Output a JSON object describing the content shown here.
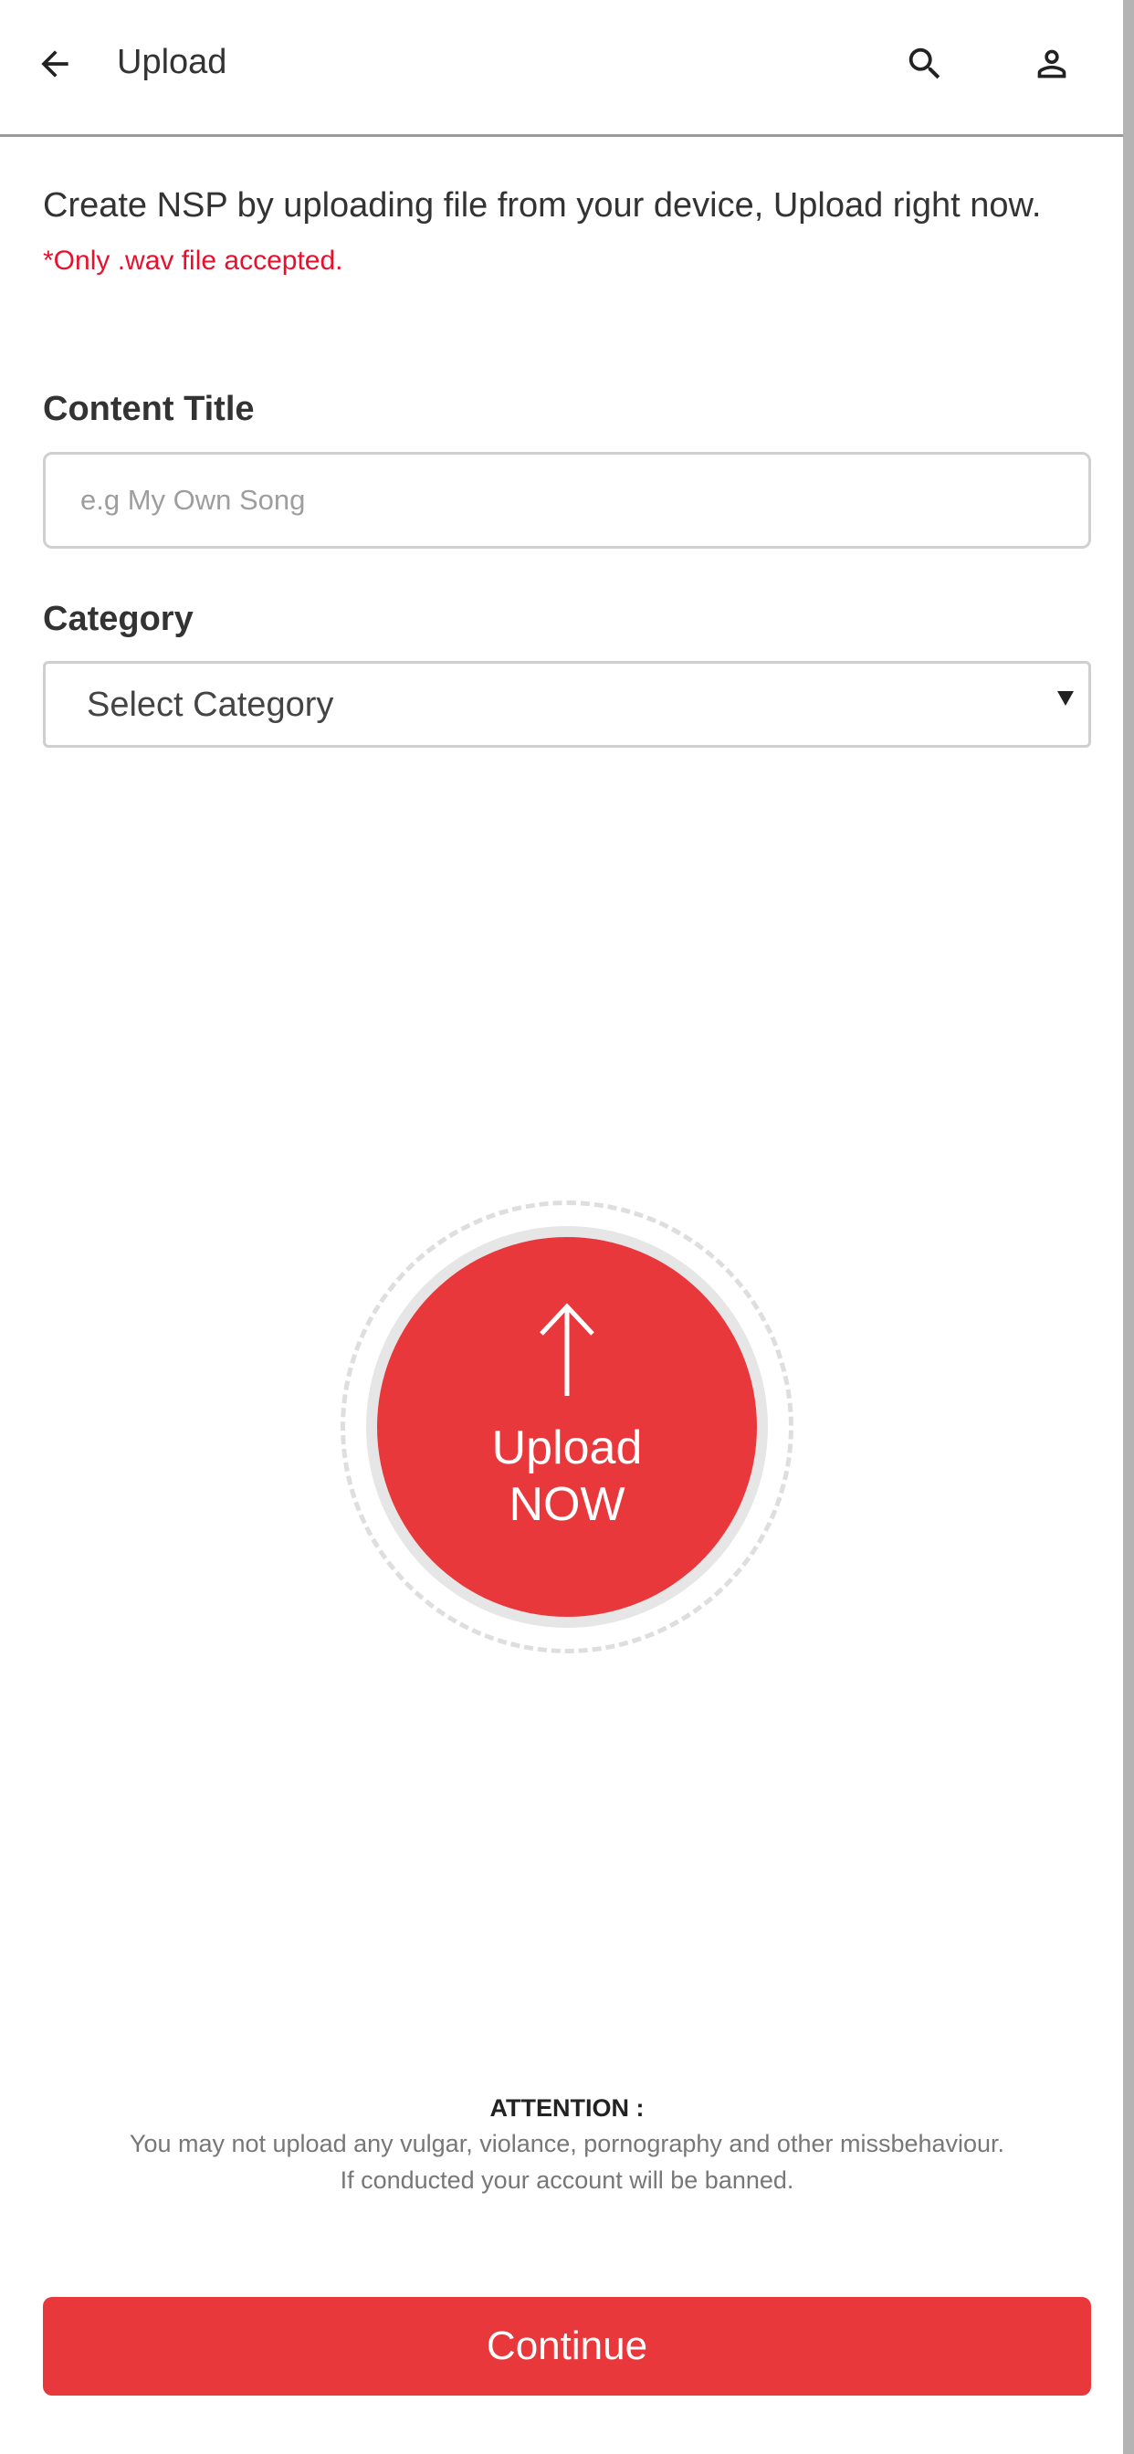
{
  "appbar": {
    "title": "Upload",
    "back_icon": "arrow-left-icon",
    "search_icon": "search-icon",
    "profile_icon": "person-icon"
  },
  "intro": {
    "text": "Create NSP by uploading file from your device, Upload right now.",
    "note": "*Only .wav file accepted."
  },
  "form": {
    "content_title_label": "Content Title",
    "content_title_placeholder": "e.g My Own Song",
    "content_title_value": "",
    "category_label": "Category",
    "category_selected": "Select Category"
  },
  "upload": {
    "line1": "Upload",
    "line2": "NOW",
    "icon": "arrow-up-icon"
  },
  "attention": {
    "title": "ATTENTION :",
    "line1": "You may not upload any vulgar, violance, pornography and other missbehaviour.",
    "line2": "If conducted your account will be banned."
  },
  "footer": {
    "continue_label": "Continue"
  },
  "colors": {
    "accent": "#e8383b",
    "note_red": "#e8112d",
    "text": "#333333",
    "muted": "#777777"
  }
}
